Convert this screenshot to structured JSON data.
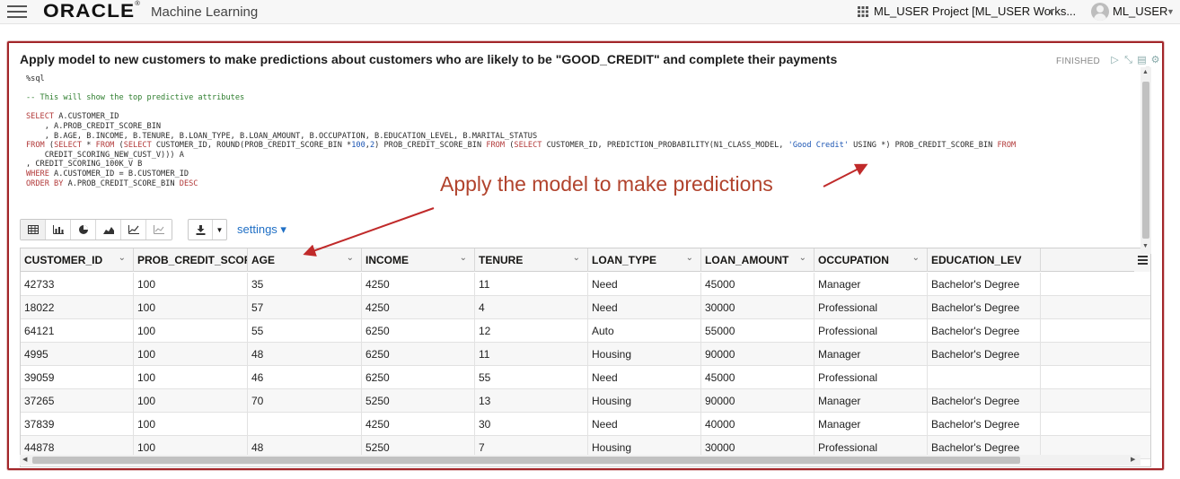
{
  "header": {
    "menu_icon": "hamburger-icon",
    "brand": "ORACLE",
    "brand_mark": "®",
    "app_name": "Machine Learning",
    "project_label": "ML_USER Project [ML_USER Works...",
    "user_label": "ML_USER"
  },
  "paragraph": {
    "title": "Apply model to new customers to make predictions about customers who are likely to be \"GOOD_CREDIT\" and complete their payments",
    "status": "FINISHED",
    "code": {
      "l1": "%sql",
      "l2": "-- This will show the top predictive attributes",
      "l3a": "SELECT",
      "l3b": " A.CUSTOMER_ID",
      "l4": "    , A.PROB_CREDIT_SCORE_BIN",
      "l5": "    , B.AGE, B.INCOME, B.TENURE, B.LOAN_TYPE, B.LOAN_AMOUNT, B.OCCUPATION, B.EDUCATION_LEVEL, B.MARITAL_STATUS",
      "l6a": "FROM",
      "l6b": " (",
      "l6c": "SELECT",
      "l6d": " * ",
      "l6e": "FROM",
      "l6f": " (",
      "l6g": "SELECT",
      "l6h": " CUSTOMER_ID, ROUND(PROB_CREDIT_SCORE_BIN *",
      "l6i": "100",
      "l6j": ",",
      "l6k": "2",
      "l6l": ") PROB_CREDIT_SCORE_BIN ",
      "l6m": "FROM",
      "l6n": " (",
      "l6o": "SELECT",
      "l6p": " CUSTOMER_ID, PREDICTION_PROBABILITY(N1_CLASS_MODEL, ",
      "l6q": "'Good Credit'",
      "l6r": " USING *) PROB_CREDIT_SCORE_BIN ",
      "l6s": "FROM",
      "l7": "    CREDIT_SCORING_NEW_CUST_V))) A",
      "l8": ", CREDIT_SCORING_100K_V B",
      "l9a": "WHERE",
      "l9b": " A.CUSTOMER_ID = B.CUSTOMER_ID",
      "l10a": "ORDER BY",
      "l10b": " A.PROB_CREDIT_SCORE_BIN ",
      "l10c": "DESC"
    }
  },
  "annotation": "Apply the model to make predictions",
  "toolbar": {
    "viz_buttons": [
      "table-icon",
      "bar-chart-icon",
      "pie-chart-icon",
      "area-chart-icon",
      "line-chart-icon",
      "scatter-chart-icon"
    ],
    "download_icon": "download-icon",
    "settings_label": "settings ▾"
  },
  "table": {
    "columns": [
      "CUSTOMER_ID",
      "PROB_CREDIT_SCORE_BIN",
      "AGE",
      "INCOME",
      "TENURE",
      "LOAN_TYPE",
      "LOAN_AMOUNT",
      "OCCUPATION",
      "EDUCATION_LEVEL"
    ],
    "column_header_last_visible": "EDUCATION_LEV",
    "rows": [
      [
        "42733",
        "100",
        "35",
        "4250",
        "11",
        "Need",
        "45000",
        "Manager",
        "Bachelor's Degree"
      ],
      [
        "18022",
        "100",
        "57",
        "4250",
        "4",
        "Need",
        "30000",
        "Professional",
        "Bachelor's Degree"
      ],
      [
        "64121",
        "100",
        "55",
        "6250",
        "12",
        "Auto",
        "55000",
        "Professional",
        "Bachelor's Degree"
      ],
      [
        "4995",
        "100",
        "48",
        "6250",
        "11",
        "Housing",
        "90000",
        "Manager",
        "Bachelor's Degree"
      ],
      [
        "39059",
        "100",
        "46",
        "6250",
        "55",
        "Need",
        "45000",
        "Professional",
        ""
      ],
      [
        "37265",
        "100",
        "70",
        "5250",
        "13",
        "Housing",
        "90000",
        "Manager",
        "Bachelor's Degree"
      ],
      [
        "37839",
        "100",
        "",
        "4250",
        "30",
        "Need",
        "40000",
        "Manager",
        "Bachelor's Degree"
      ],
      [
        "44878",
        "100",
        "48",
        "5250",
        "7",
        "Housing",
        "30000",
        "Professional",
        "Bachelor's Degree"
      ]
    ]
  },
  "colors": {
    "highlight_border": "#a3262a",
    "annotation": "#b1432d",
    "link": "#1f6fc5"
  }
}
